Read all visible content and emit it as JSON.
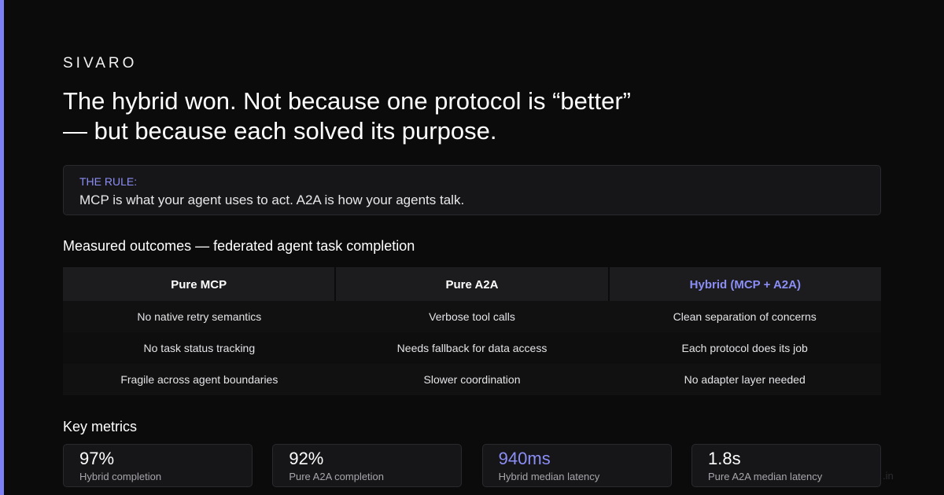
{
  "brand": "SIVARO",
  "headline": "The hybrid won. Not because one protocol is “better” — but because each solved its purpose.",
  "rule": {
    "label": "THE RULE:",
    "text": "MCP is what your agent uses to act. A2A is how your agents talk."
  },
  "outcomes": {
    "title": "Measured outcomes — federated agent task completion",
    "columns": [
      "Pure MCP",
      "Pure A2A",
      "Hybrid (MCP + A2A)"
    ],
    "rows": [
      [
        "No native retry semantics",
        "Verbose tool calls",
        "Clean separation of concerns"
      ],
      [
        "No task status tracking",
        "Needs fallback for data access",
        "Each protocol does its job"
      ],
      [
        "Fragile across agent boundaries",
        "Slower coordination",
        "No adapter layer needed"
      ]
    ]
  },
  "metrics": {
    "title": "Key metrics",
    "items": [
      {
        "value": "97%",
        "label": "Hybrid completion"
      },
      {
        "value": "92%",
        "label": "Pure A2A completion"
      },
      {
        "value": "940ms",
        "label": "Hybrid median latency"
      },
      {
        "value": "1.8s",
        "label": "Pure A2A median latency"
      }
    ]
  },
  "watermark": ".in",
  "colors": {
    "accent": "#7c7ff6",
    "highlight_text": "#8b8ef4",
    "background": "#0b0b0c"
  }
}
